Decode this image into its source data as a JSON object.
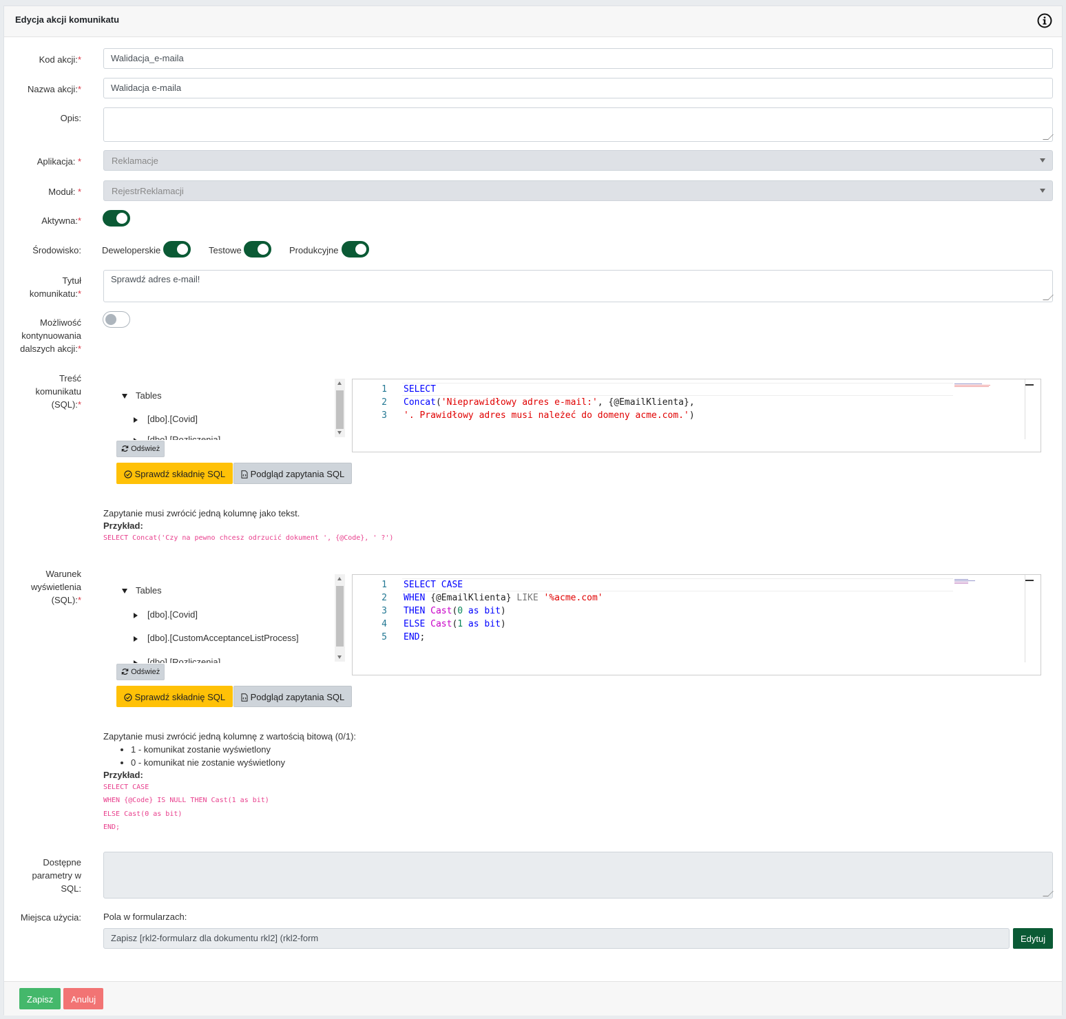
{
  "header": {
    "title": "Edycja akcji komunikatu",
    "info_icon": "info-circle-icon"
  },
  "labels": {
    "kod_akcji": "Kod akcji:",
    "nazwa_akcji": "Nazwa akcji:",
    "opis": "Opis:",
    "aplikacja": "Aplikacja: ",
    "modul": "Moduł: ",
    "aktywna": "Aktywna:",
    "srodowisko": "Środowisko:",
    "tytul_1": "Tytuł",
    "tytul_2": "komunikatu:",
    "mozliwosc_1": "Możliwość",
    "mozliwosc_2": "kontynuowania",
    "mozliwosc_3": "dalszych akcji:",
    "tresc_1": "Treść",
    "tresc_2": "komunikatu",
    "tresc_3": "(SQL):",
    "warunek_1": "Warunek",
    "warunek_2": "wyświetlenia",
    "warunek_3": "(SQL):",
    "dostepne_1": "Dostępne",
    "dostepne_2": "parametry w",
    "dostepne_3": "SQL:",
    "miejsca": "Miejsca użycia:",
    "required_mark": "*"
  },
  "fields": {
    "kod_akcji": "Walidacja_e-maila",
    "nazwa_akcji": "Walidacja e-maila",
    "opis": "",
    "aplikacja": "Reklamacje",
    "modul": "RejestrReklamacji",
    "aktywna": true,
    "tytul": "Sprawdź adres e-mail!",
    "mozliwosc": false,
    "dostepne_parametry": ""
  },
  "environments": [
    {
      "label": "Deweloperskie",
      "on": true
    },
    {
      "label": "Testowe",
      "on": true
    },
    {
      "label": "Produkcyjne",
      "on": true
    }
  ],
  "sql1": {
    "tree_root": "Tables",
    "tree_items": [
      "[dbo].[Covid]",
      "[dbo].[Rozliczenia]"
    ],
    "refresh": "Odśwież",
    "check": "Sprawdź składnię SQL",
    "preview": "Podgląd zapytania SQL",
    "line_numbers": [
      "1",
      "2",
      "3"
    ],
    "code": {
      "l1_kw": "SELECT",
      "l2_fn": "Concat",
      "l2_p1": "(",
      "l2_str": "'Nieprawidłowy adres e-mail:'",
      "l2_rest": ", {@EmailKlienta},",
      "l3_str": "'. Prawidłowy adres musi należeć do domeny acme.com.'",
      "l3_rest": ")"
    },
    "hint": "Zapytanie musi zwrócić jedną kolumnę jako tekst.",
    "example_label": "Przykład:",
    "example": "SELECT Concat('Czy na pewno chcesz odrzucić dokument ', {@Code}, ' ?')"
  },
  "sql2": {
    "tree_root": "Tables",
    "tree_items": [
      "[dbo].[Covid]",
      "[dbo].[CustomAcceptanceListProcess]",
      "[dbo].[Rozliczenia]"
    ],
    "refresh": "Odśwież",
    "check": "Sprawdź składnię SQL",
    "preview": "Podgląd zapytania SQL",
    "line_numbers": [
      "1",
      "2",
      "3",
      "4",
      "5"
    ],
    "code": {
      "l1_kw": "SELECT CASE",
      "l2_kw": "WHEN",
      "l2_param": " {@EmailKlienta} ",
      "l2_like": "LIKE",
      "l2_str": " '%acme.com'",
      "l3_kw": "THEN",
      "l3_fn": " Cast",
      "l3_p": "(",
      "l3_num": "0",
      "l3_as": " as ",
      "l3_bit": "bit",
      "l3_end": ")",
      "l4_kw": "ELSE",
      "l4_fn": " Cast",
      "l4_p": "(",
      "l4_num": "1",
      "l4_as": " as ",
      "l4_bit": "bit",
      "l4_end": ")",
      "l5_kw": "END",
      "l5_end": ";"
    },
    "hint": "Zapytanie musi zwrócić jedną kolumnę z wartością bitową (0/1):",
    "bullets": [
      "1 - komunikat zostanie wyświetlony",
      "0 - komunikat nie zostanie wyświetlony"
    ],
    "example_label": "Przykład:",
    "example_lines": [
      "SELECT CASE",
      "WHEN {@Code} IS NULL THEN Cast(1 as bit)",
      "ELSE Cast(0 as bit)",
      "END;"
    ]
  },
  "usage": {
    "subtitle": "Pola w formularzach:",
    "value": "Zapisz [rkl2-formularz dla dokumentu rkl2] (rkl2-form",
    "edit_button": "Edytuj"
  },
  "footer": {
    "save": "Zapisz",
    "cancel": "Anuluj"
  },
  "colors": {
    "toggle_on": "#0b5a35",
    "save": "#44b86b",
    "cancel": "#f27474",
    "warning": "#ffc107"
  }
}
